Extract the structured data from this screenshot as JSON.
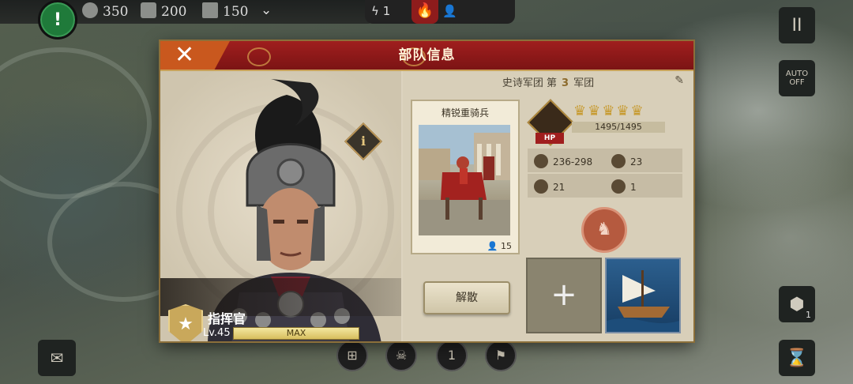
{
  "hud": {
    "alert_symbol": "!",
    "resources": [
      {
        "icon": "silver-coin-icon",
        "value": "350"
      },
      {
        "icon": "hammer-icon",
        "value": "200"
      },
      {
        "icon": "scroll-icon",
        "value": "150"
      }
    ],
    "expand_symbol": "⌄",
    "lightning_value": "1",
    "fire_symbol": "🔥"
  },
  "right_buttons": {
    "pause_symbol": "II",
    "auto_label": "AUTO",
    "auto_sub": "OFF",
    "hex_count": "1",
    "hourglass_symbol": "⌛"
  },
  "panel": {
    "title": "部队信息",
    "close_symbol": "✕",
    "commander": {
      "info_symbol": "i",
      "title": "指挥官",
      "level": "Lv.45",
      "exp_label": "MAX"
    },
    "legion": {
      "prefix": "史诗军团 第",
      "number": "3",
      "suffix": "军团",
      "edit_symbol": "✎"
    },
    "unit_card": {
      "name": "精锐重骑兵",
      "count": "15"
    },
    "stats": {
      "hp_label": "HP",
      "helmets": "♛♛♛♛♛",
      "hp_value": "1495/1495",
      "attack": "236-298",
      "defense": "23",
      "movement": "21",
      "vision": "1"
    },
    "disband_label": "解散",
    "add_symbol": "+"
  },
  "bottom": {
    "items": [
      "⊞",
      "☠",
      "1",
      "⚑"
    ]
  },
  "colors": {
    "header_red": "#a01e1e",
    "close_orange": "#c9581e",
    "panel_bg": "#dcd3bf",
    "gold": "#c9a85b"
  }
}
